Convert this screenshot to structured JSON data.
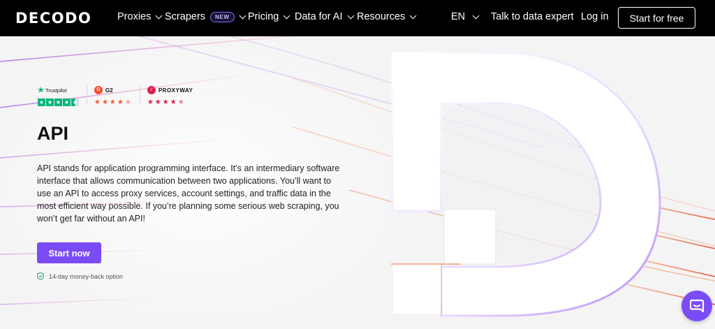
{
  "nav": {
    "logo": "DECODO",
    "items": [
      {
        "label": "Proxies"
      },
      {
        "label": "Scrapers",
        "badge": "NEW"
      },
      {
        "label": "Pricing"
      },
      {
        "label": "Data for AI"
      },
      {
        "label": "Resources"
      }
    ],
    "language": "EN",
    "talk_label": "Talk to data expert",
    "login_label": "Log in",
    "cta_label": "Start for free"
  },
  "ratings": [
    {
      "name": "Trustpilot",
      "icon": "trustpilot-star-icon",
      "stars": 4.5
    },
    {
      "name": "G2",
      "icon": "g2-logo-icon",
      "stars": 4.5
    },
    {
      "name": "PROXYWAY",
      "icon": "proxyway-logo-icon",
      "stars": 4.5
    }
  ],
  "hero": {
    "title": "API",
    "description": "API stands for application programming interface. It’s an intermediary software interface that allows communication between two applications. You’ll want to use an API to access proxy services, account settings, and traffic data in the most efficient way possible. If you’re planning some serious web scraping, you won’t get far without an API!",
    "cta_label": "Start now",
    "guarantee": "14-day money-back option"
  },
  "colors": {
    "accent": "#7b4cf5",
    "nav_bg": "#000000",
    "trustpilot": "#00b67a",
    "g2": "#ef5a3c",
    "proxyway": "#d9214b"
  }
}
